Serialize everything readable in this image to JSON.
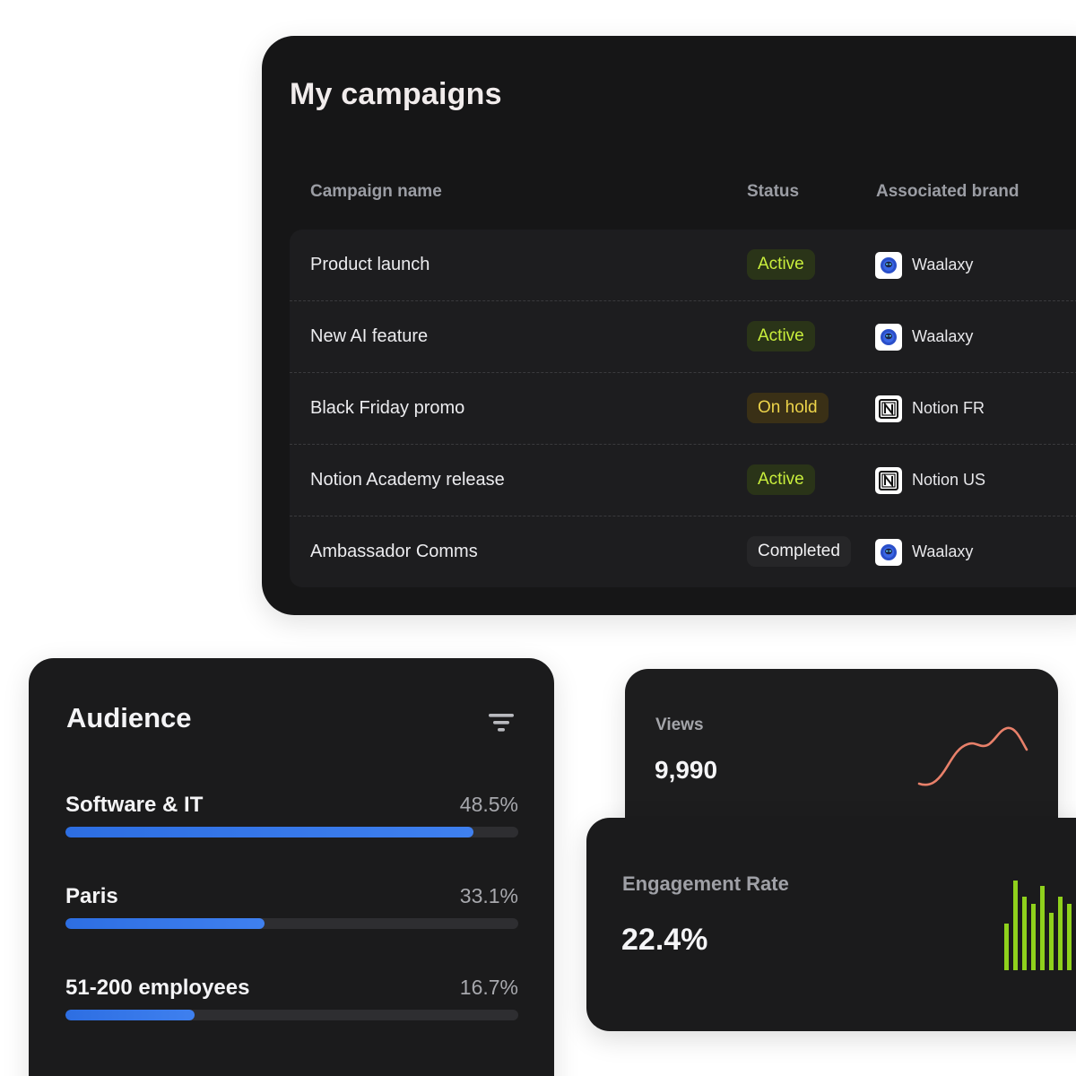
{
  "campaigns": {
    "title": "My campaigns",
    "columns": {
      "name": "Campaign name",
      "status": "Status",
      "brand": "Associated brand"
    },
    "rows": [
      {
        "name": "Product launch",
        "status": "Active",
        "status_type": "active",
        "brand": "Waalaxy",
        "brand_icon": "alien-icon"
      },
      {
        "name": "New AI feature",
        "status": "Active",
        "status_type": "active",
        "brand": "Waalaxy",
        "brand_icon": "alien-icon"
      },
      {
        "name": "Black Friday promo",
        "status": "On hold",
        "status_type": "hold",
        "brand": "Notion FR",
        "brand_icon": "notion-icon"
      },
      {
        "name": "Notion Academy release",
        "status": "Active",
        "status_type": "active",
        "brand": "Notion US",
        "brand_icon": "notion-icon"
      },
      {
        "name": "Ambassador Comms",
        "status": "Completed",
        "status_type": "done",
        "brand": "Waalaxy",
        "brand_icon": "alien-icon"
      }
    ]
  },
  "audience": {
    "title": "Audience",
    "filter_icon": "filter-icon",
    "items": [
      {
        "label": "Software & IT",
        "value": "48.5%",
        "fraction": 0.9
      },
      {
        "label": "Paris",
        "value": "33.1%",
        "fraction": 0.44
      },
      {
        "label": "51-200 employees",
        "value": "16.7%",
        "fraction": 0.285
      }
    ]
  },
  "views": {
    "label": "Views",
    "value": "9,990",
    "sparkline_color": "#e8806a",
    "sparkline_icon": "sparkline-chart"
  },
  "engagement": {
    "label": "Engagement Rate",
    "value": "22.4%",
    "bars_color": "#8fd11c",
    "bars_icon": "bar-chart"
  },
  "colors": {
    "card_bg": "#161617",
    "active_text": "#c9ee3c",
    "hold_text": "#ecd34a",
    "progress": "#3a7be8"
  }
}
